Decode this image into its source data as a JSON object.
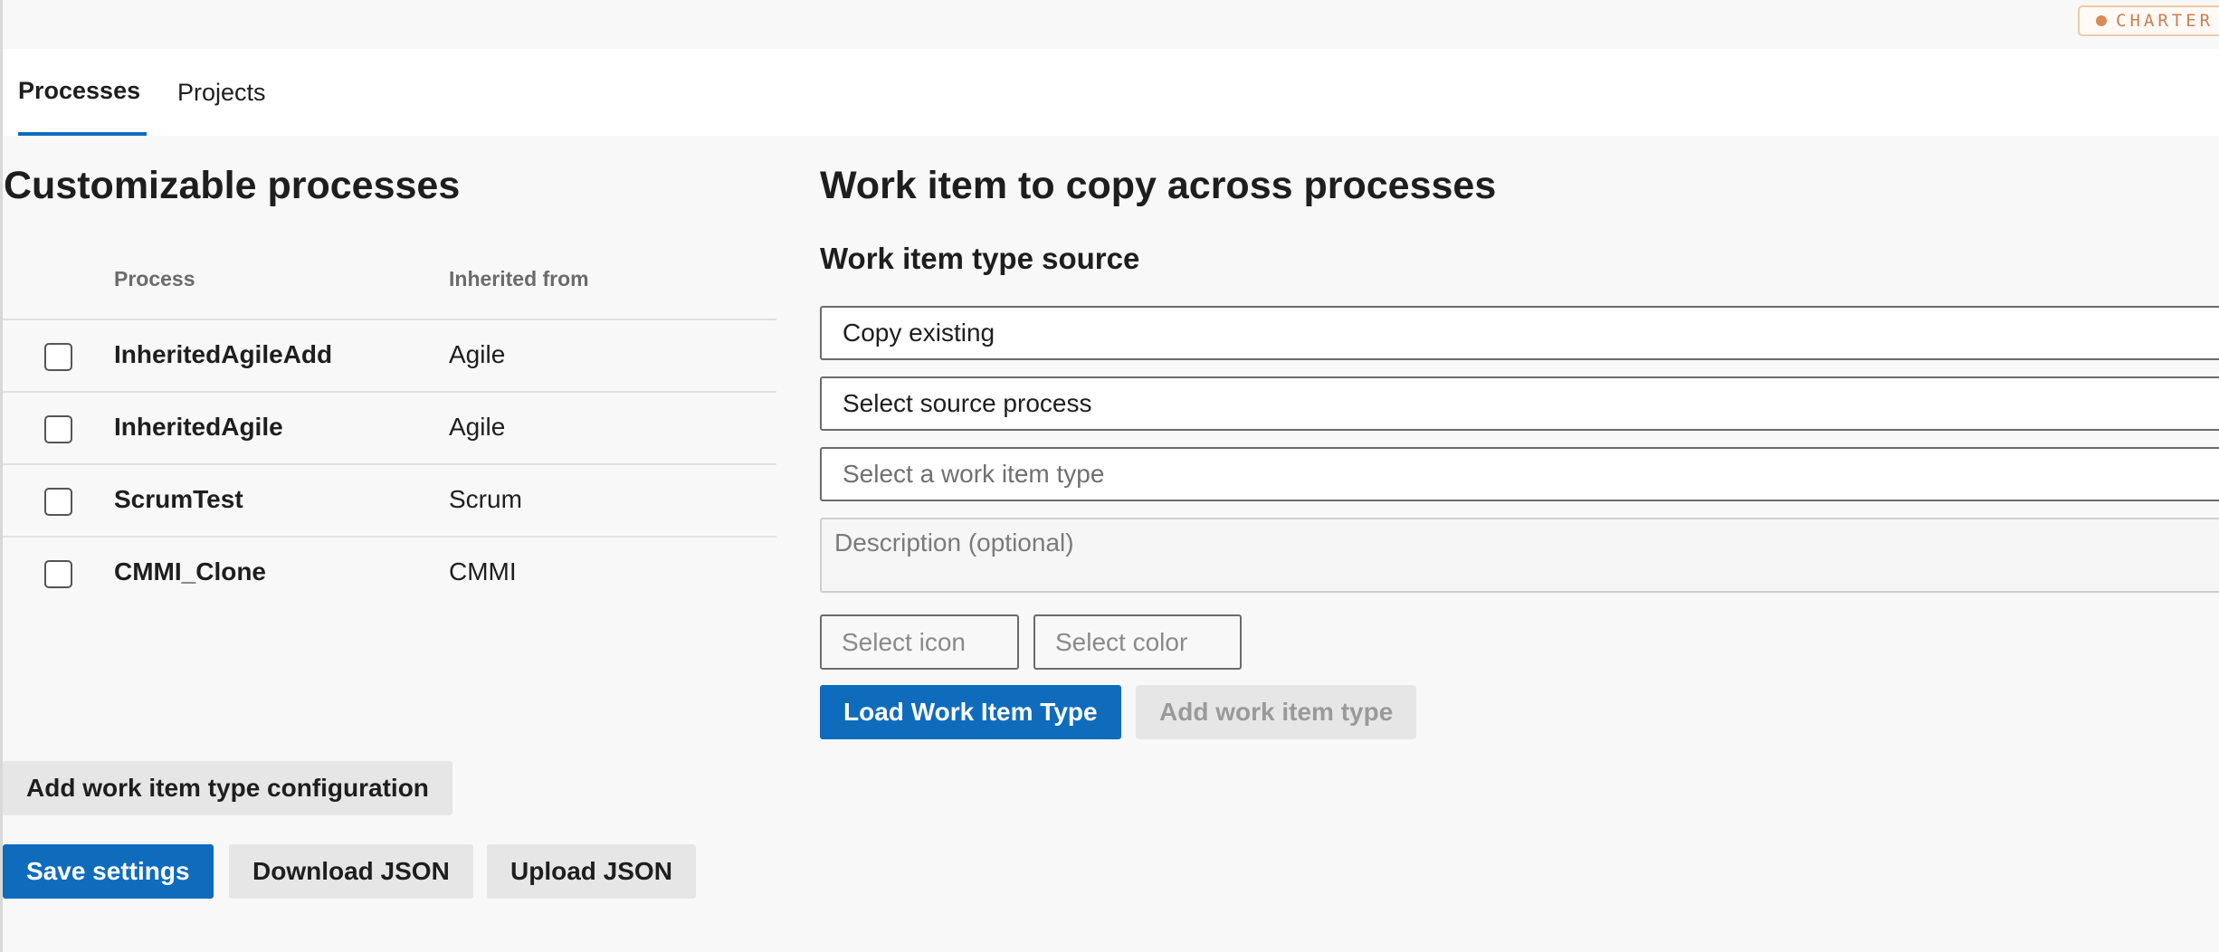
{
  "badge": {
    "label": "CHARTER"
  },
  "tabs": [
    {
      "label": "Processes",
      "active": true
    },
    {
      "label": "Projects",
      "active": false
    }
  ],
  "processes": {
    "title": "Customizable processes",
    "columns": {
      "process": "Process",
      "inherited": "Inherited from"
    },
    "rows": [
      {
        "name": "InheritedAgileAdd",
        "inherited": "Agile",
        "checked": false
      },
      {
        "name": "InheritedAgile",
        "inherited": "Agile",
        "checked": false
      },
      {
        "name": "ScrumTest",
        "inherited": "Scrum",
        "checked": false
      },
      {
        "name": "CMMI_Clone",
        "inherited": "CMMI",
        "checked": false
      }
    ],
    "add_config_label": "Add work item type configuration",
    "save_label": "Save settings",
    "download_label": "Download JSON",
    "upload_label": "Upload JSON"
  },
  "copy": {
    "title": "Work item to copy across processes",
    "source_title": "Work item type source",
    "source_mode": "Copy existing",
    "source_process": "Select source process",
    "work_item_type_placeholder": "Select a work item type",
    "description_placeholder": "Description (optional)",
    "icon_placeholder": "Select icon",
    "color_placeholder": "Select color",
    "load_label": "Load Work Item Type",
    "add_label": "Add work item type"
  },
  "colors": {
    "accent": "#0f6cbd",
    "badge": "#cc7f4f"
  }
}
